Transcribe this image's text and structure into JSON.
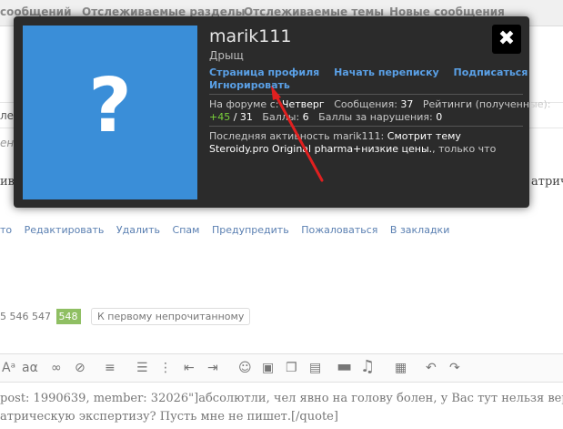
{
  "topnav": {
    "items": [
      "сообщений",
      "Отслеживаемые разделы",
      "Отслеживаемые темы",
      "Новые сообщения"
    ]
  },
  "background": {
    "left_fragments": [
      "ле:",
      "ени",
      "ив"
    ],
    "right_fragment": "атрич",
    "actions": [
      "то",
      "Редактировать",
      "Удалить",
      "Спам",
      "Предупредить",
      "Пожаловаться",
      "В закладки"
    ],
    "pager": {
      "pages": [
        "5",
        "546",
        "547"
      ],
      "current": "548",
      "unread_label": "К первому непрочитанному"
    },
    "editor_line1": "post: 1990639, member: 32026\"]абсолютли, чел явно на голову болен, у Вас тут нельзя вер",
    "editor_line2": "атрическую экспертизу? Пусть мне не пишет.[/quote]"
  },
  "profile_card": {
    "close_label": "✖",
    "username": "marik111",
    "user_title": "Дрыщ",
    "avatar_glyph": "?",
    "links": [
      "Страница профиля",
      "Начать переписку",
      "Подписаться"
    ],
    "ignore_label": "Игнорировать",
    "stats": {
      "joined_label": "На форуме с:",
      "joined_value": "Четверг",
      "messages_label": "Сообщения:",
      "messages_value": "37",
      "ratings_label": "Рейтинги (полученные):",
      "ratings_pos": "+45",
      "ratings_total": "/ 31",
      "points_label": "Баллы:",
      "points_value": "6",
      "violation_label": "Баллы за нарушения:",
      "violation_value": "0"
    },
    "activity": {
      "prefix": "Последняя активность marik111:",
      "thread": "Смотрит тему Steroidy.pro Original pharma+низкие цены.",
      "suffix": ", только что"
    }
  },
  "colors": {
    "avatar_bg": "#3a8ed8",
    "card_bg": "#2b2b2b",
    "link": "#5aa0e6",
    "positive": "#79d13b",
    "arrow": "#e02020"
  },
  "icons": [
    "close-icon",
    "bold-icon",
    "text-size-icon",
    "link-icon",
    "unlink-icon",
    "align-icon",
    "list-icon",
    "indent-icon",
    "smiley-icon",
    "image-icon",
    "media-icon",
    "code-icon",
    "speech-icon",
    "music-icon",
    "save-icon",
    "undo-icon",
    "redo-icon"
  ]
}
